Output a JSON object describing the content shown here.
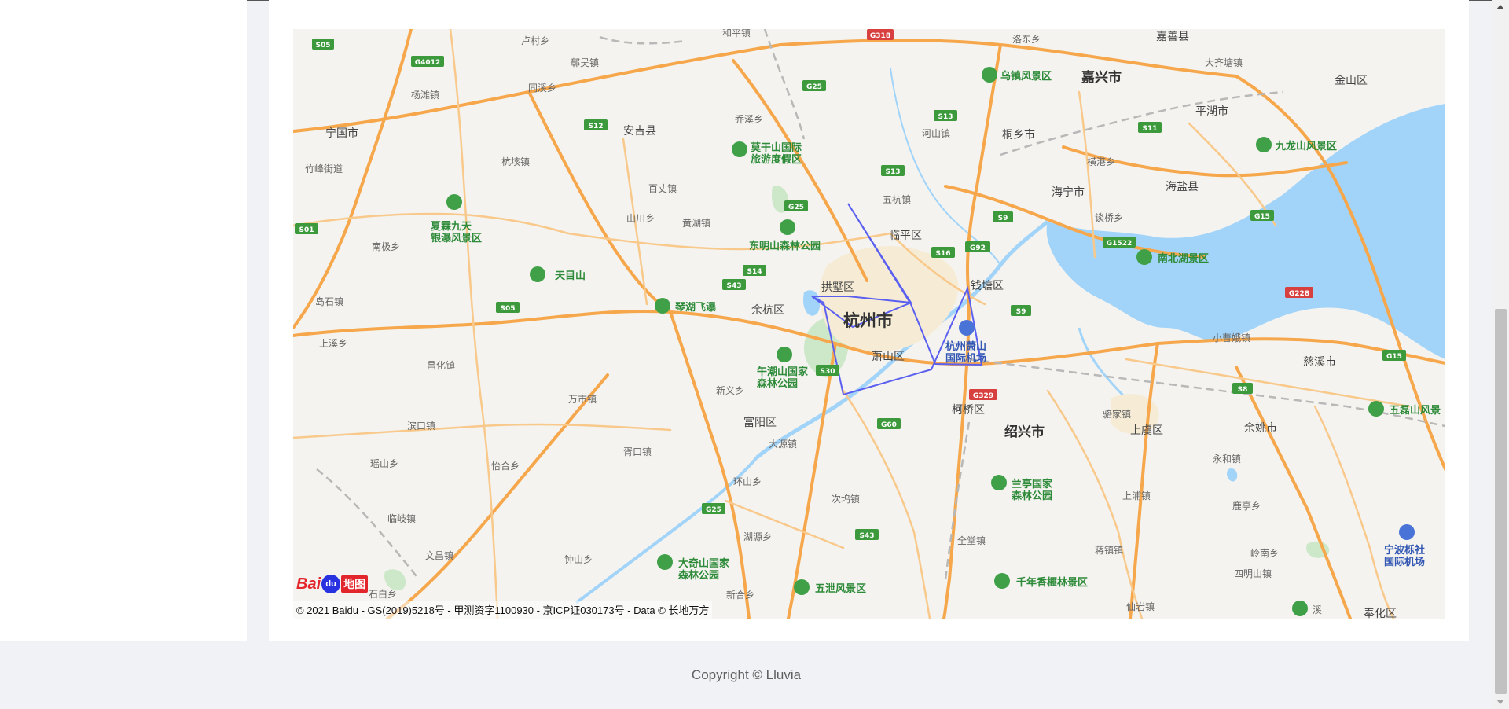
{
  "footer": {
    "copyright": "Copyright © Lluvia"
  },
  "map": {
    "attribution": "© 2021 Baidu - GS(2019)5218号 - 甲测资字1100930 - 京ICP证030173号 - Data © 长地万方",
    "logo_text": "Bai",
    "logo_text_2": "地图",
    "logo_paw_text": "du",
    "water_color": "#a2d4f9",
    "major_road_color": "#f6a74c",
    "minor_road_color": "#f8c98b",
    "polygon_color": "#5a5ff0",
    "places": {
      "hangzhou": "杭州市",
      "jiaxing": "嘉兴市",
      "shaoxing": "绍兴市",
      "ningguo": "宁国市",
      "anji": "安吉县",
      "haining": "海宁市",
      "tongxiang": "桐乡市",
      "haiyan": "海盐县",
      "pinghu": "平湖市",
      "jinshan": "金山区",
      "jiashan": "嘉善县",
      "linping": "临平区",
      "gongshu": "拱墅区",
      "yuhang": "余杭区",
      "xiaoshan": "萧山区",
      "qiantang": "钱塘区",
      "fuyang": "富阳区",
      "keqiao": "柯桥区",
      "shangyu": "上虞区",
      "yuyao": "余姚市",
      "cixi": "慈溪市",
      "fenghua": "奉化区",
      "tianmu": "天目山",
      "qinhu": "琴湖飞瀑",
      "moganshan": "莫干山国际\n旅游度假区",
      "dongmingshan": "东明山森林公园",
      "wuzhen": "乌镇风景区",
      "jiulongshan": "九龙山风景区",
      "nanbeihu": "南北湖景区",
      "xiaxia": "夏霖九天\n银瀑风景区",
      "wuchaoshan": "午潮山国家\n森林公园",
      "lanting": "兰亭国家\n森林公园",
      "daqishan": "大奇山国家\n森林公园",
      "wuxie": "五泄风景区",
      "qiannian": "千年香榧林景区",
      "wulei": "五磊山风景",
      "airport_hz": "杭州萧山\n国际机场",
      "airport_nb": "宁波栎社\n国际机场",
      "town_1": "卢村乡",
      "town_2": "和平镇",
      "town_3": "洛东乡",
      "town_4": "大齐塘镇",
      "town_5": "鄣吴镇",
      "town_6": "杨滩镇",
      "town_7": "同溪乡",
      "town_8": "乔溪乡",
      "town_9": "河山镇",
      "town_10": "杭垓镇",
      "town_11": "竹峰街道",
      "town_12": "百丈镇",
      "town_13": "五杭镇",
      "town_14": "横港乡",
      "town_15": "山川乡",
      "town_16": "黄湖镇",
      "town_17": "谈桥乡",
      "town_18": "南极乡",
      "town_19": "岛石镇",
      "town_20": "上溪乡",
      "town_21": "昌化镇",
      "town_22": "万市镇",
      "town_23": "新义乡",
      "town_24": "小曹娥镇",
      "town_25": "滨口镇",
      "town_26": "瑶山乡",
      "town_27": "怡合乡",
      "town_28": "胥口镇",
      "town_29": "大源镇",
      "town_30": "骆家镇",
      "town_31": "永和镇",
      "town_32": "临岐镇",
      "town_33": "环山乡",
      "town_34": "次坞镇",
      "town_35": "上浦镇",
      "town_36": "鹿亭乡",
      "town_37": "文昌镇",
      "town_38": "湖源乡",
      "town_39": "全堂镇",
      "town_40": "蒋镇镇",
      "town_41": "岭南乡",
      "town_42": "钟山乡",
      "town_43": "新合乡",
      "town_44": "四明山镇",
      "town_45": "石白乡",
      "town_46": "仙岩镇",
      "town_47": "溪"
    },
    "shields": {
      "s505a": "S05",
      "g4012": "G4012",
      "g318": "G318",
      "g25a": "G25",
      "s12": "S12",
      "s13a": "S13",
      "s13b": "S13",
      "s11": "S11",
      "g25b": "G25",
      "s501": "S01",
      "s9a": "S9",
      "s16": "S16",
      "g92": "G92",
      "g1522": "G1522",
      "s14": "S14",
      "s43a": "S43",
      "s505b": "S05",
      "s9b": "S9",
      "g228": "G228",
      "g15a": "G15",
      "g15b": "G15",
      "s30": "S30",
      "g329": "G329",
      "s8": "S8",
      "g60": "G60",
      "g25c": "G25",
      "s43b": "S43"
    }
  }
}
